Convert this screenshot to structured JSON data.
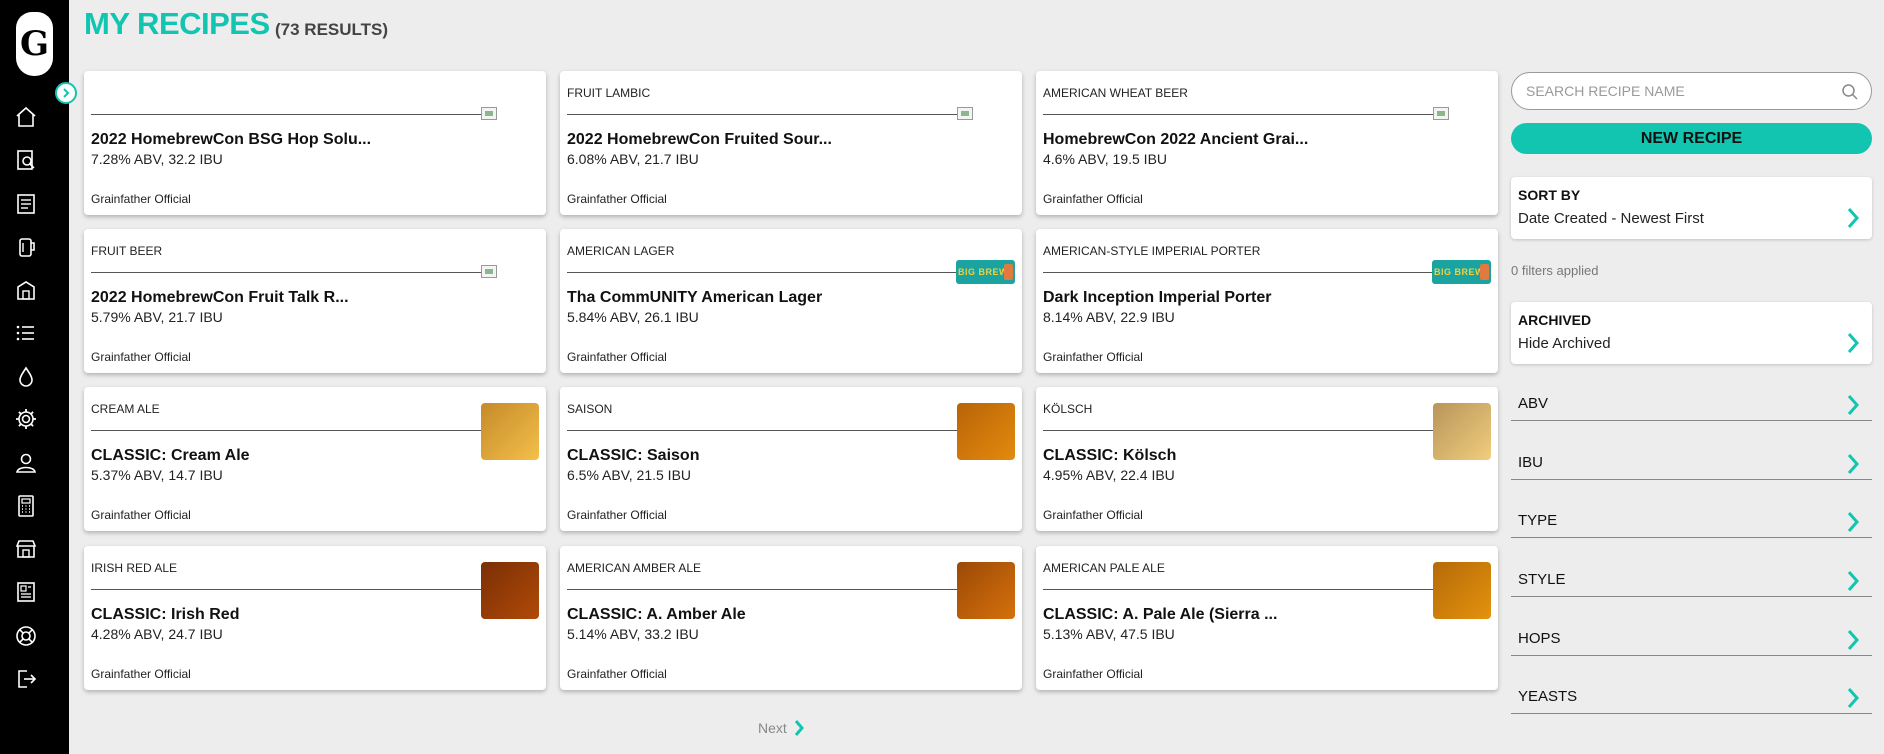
{
  "sidebar": {
    "logo_letter": "G",
    "icons": [
      "home-icon",
      "recipe-search-icon",
      "notebook-icon",
      "fermenter-icon",
      "brewery-icon",
      "list-icon",
      "water-drop-icon",
      "gear-icon",
      "user-icon",
      "calculator-icon",
      "store-icon",
      "news-icon",
      "help-lifebuoy-icon",
      "logout-icon"
    ]
  },
  "header": {
    "title": "MY RECIPES",
    "count": "(73 RESULTS)"
  },
  "recipes": [
    {
      "style": "",
      "name": "2022 HomebrewCon BSG Hop Solu...",
      "stats": "7.28% ABV, 32.2 IBU",
      "author": "Grainfather Official",
      "thumb": "broken"
    },
    {
      "style": "FRUIT LAMBIC",
      "name": "2022 HomebrewCon Fruited Sour...",
      "stats": "6.08% ABV, 21.7 IBU",
      "author": "Grainfather Official",
      "thumb": "broken"
    },
    {
      "style": "AMERICAN WHEAT BEER",
      "name": "HomebrewCon 2022 Ancient Grai...",
      "stats": "4.6% ABV, 19.5 IBU",
      "author": "Grainfather Official",
      "thumb": "broken"
    },
    {
      "style": "FRUIT BEER",
      "name": "2022 HomebrewCon Fruit Talk R...",
      "stats": "5.79% ABV, 21.7 IBU",
      "author": "Grainfather Official",
      "thumb": "broken"
    },
    {
      "style": "AMERICAN LAGER",
      "name": "Tha CommUNITY American Lager",
      "stats": "5.84% ABV, 26.1 IBU",
      "author": "Grainfather Official",
      "thumb": "badge",
      "badge_text": "BIG BREW"
    },
    {
      "style": "AMERICAN-STYLE IMPERIAL PORTER",
      "name": "Dark Inception Imperial Porter",
      "stats": "8.14% ABV, 22.9 IBU",
      "author": "Grainfather Official",
      "thumb": "badge",
      "badge_text": "BIG BREW"
    },
    {
      "style": "CREAM ALE",
      "name": "CLASSIC: Cream Ale",
      "stats": "5.37% ABV, 14.7 IBU",
      "author": "Grainfather Official",
      "thumb": "color",
      "color_a": "#c58a2a",
      "color_b": "#f3c04a"
    },
    {
      "style": "SAISON",
      "name": "CLASSIC: Saison",
      "stats": "6.5% ABV, 21.5 IBU",
      "author": "Grainfather Official",
      "thumb": "color",
      "color_a": "#b86408",
      "color_b": "#e48a0e"
    },
    {
      "style": "KÖLSCH",
      "name": "CLASSIC: Kölsch",
      "stats": "4.95% ABV, 22.4 IBU",
      "author": "Grainfather Official",
      "thumb": "color",
      "color_a": "#b8955a",
      "color_b": "#f1cd7d"
    },
    {
      "style": "IRISH RED ALE",
      "name": "CLASSIC: Irish Red",
      "stats": "4.28% ABV, 24.7 IBU",
      "author": "Grainfather Official",
      "thumb": "color",
      "color_a": "#7a2f05",
      "color_b": "#b04a08"
    },
    {
      "style": "AMERICAN AMBER ALE",
      "name": "CLASSIC: A. Amber Ale",
      "stats": "5.14% ABV, 33.2 IBU",
      "author": "Grainfather Official",
      "thumb": "color",
      "color_a": "#9a4a06",
      "color_b": "#d6700c"
    },
    {
      "style": "AMERICAN PALE ALE",
      "name": "CLASSIC: A. Pale Ale (Sierra ...",
      "stats": "5.13% ABV, 47.5 IBU",
      "author": "Grainfather Official",
      "thumb": "color",
      "color_a": "#b56a08",
      "color_b": "#e4920e"
    }
  ],
  "pager": {
    "next_label": "Next"
  },
  "right_panel": {
    "search_placeholder": "SEARCH RECIPE NAME",
    "new_recipe_label": "NEW RECIPE",
    "sort_by": {
      "label": "SORT BY",
      "value": "Date Created - Newest First"
    },
    "filters_applied": "0 filters applied",
    "archived": {
      "label": "ARCHIVED",
      "value": "Hide Archived"
    },
    "filters": [
      "ABV",
      "IBU",
      "TYPE",
      "STYLE",
      "HOPS",
      "YEASTS"
    ]
  },
  "colors": {
    "accent": "#12c5b0",
    "sidebar": "#000000",
    "background": "#ecedec"
  }
}
